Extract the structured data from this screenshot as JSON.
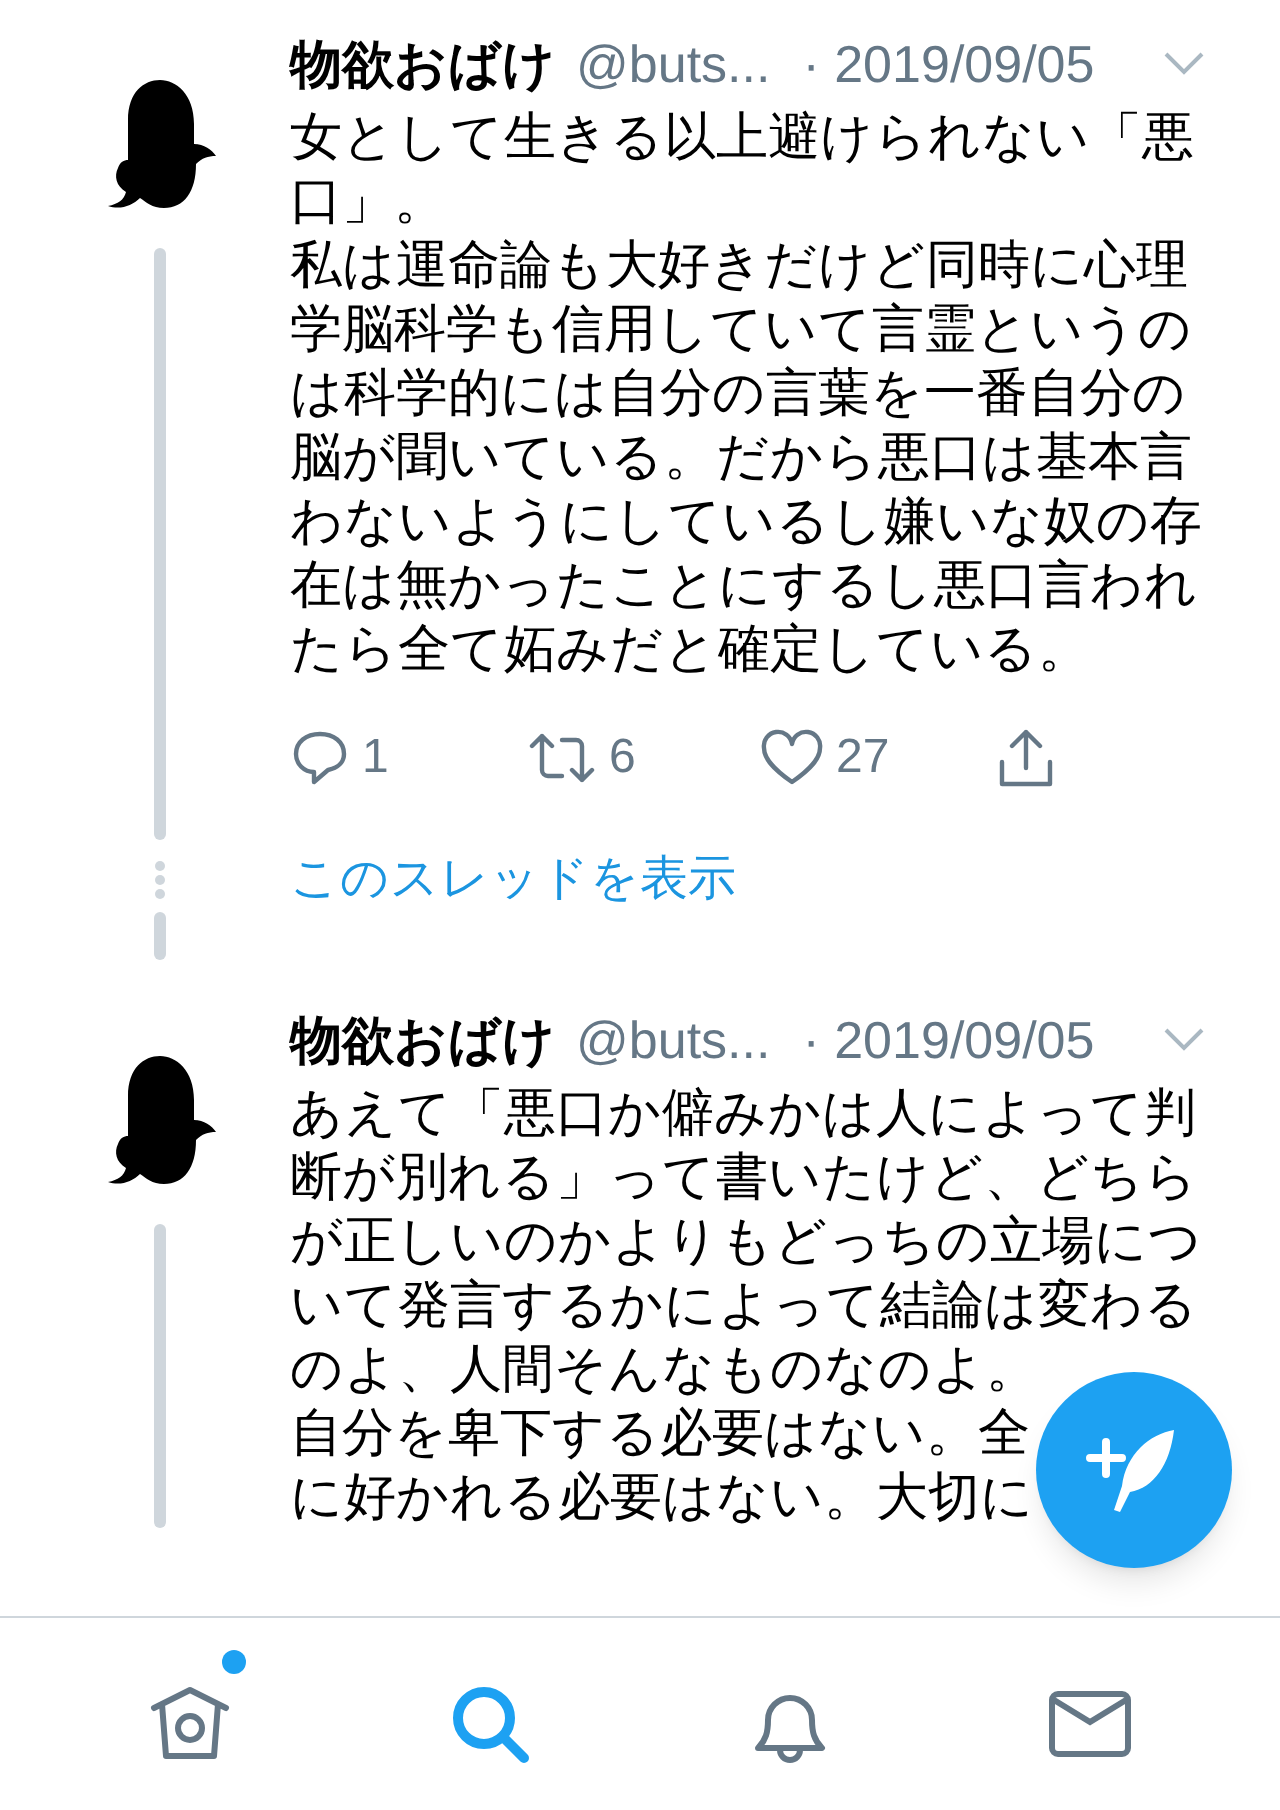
{
  "tweets": [
    {
      "name": "物欲おばけ",
      "handle": "@buts...",
      "date": "· 2019/09/05",
      "lines": [
        "女として生きる以上避けられない「悪",
        "口」。",
        "私は運命論も大好きだけど同時に心理",
        "学脳科学も信用していて言霊というの",
        "は科学的には自分の言葉を一番自分の",
        "脳が聞いている。だから悪口は基本言",
        "わないようにしているし嫌いな奴の存",
        "在は無かったことにするし悪口言われ",
        "たら全て妬みだと確定している。"
      ],
      "actions": [
        {
          "kind": "reply",
          "count": "1"
        },
        {
          "kind": "retweet",
          "count": "6"
        },
        {
          "kind": "like",
          "count": "27"
        },
        {
          "kind": "share"
        }
      ],
      "thread_link": "このスレッドを表示"
    },
    {
      "name": "物欲おばけ",
      "handle": "@buts...",
      "date": "· 2019/09/05",
      "lines": [
        "あえて「悪口か僻みかは人によって判",
        "断が別れる」って書いたけど、どちら",
        "が正しいのかよりもどっちの立場につ",
        "いて発言するかによって結論は変わる",
        "のよ、人間そんなものなのよ。",
        "自分を卑下する必要はない。全",
        "に好かれる必要はない。大切に"
      ]
    }
  ],
  "nav": [
    {
      "kind": "home",
      "selected": false,
      "unread": true
    },
    {
      "kind": "search",
      "selected": true,
      "unread": false
    },
    {
      "kind": "notifications",
      "selected": false,
      "unread": false
    },
    {
      "kind": "messages",
      "selected": false,
      "unread": false
    }
  ]
}
